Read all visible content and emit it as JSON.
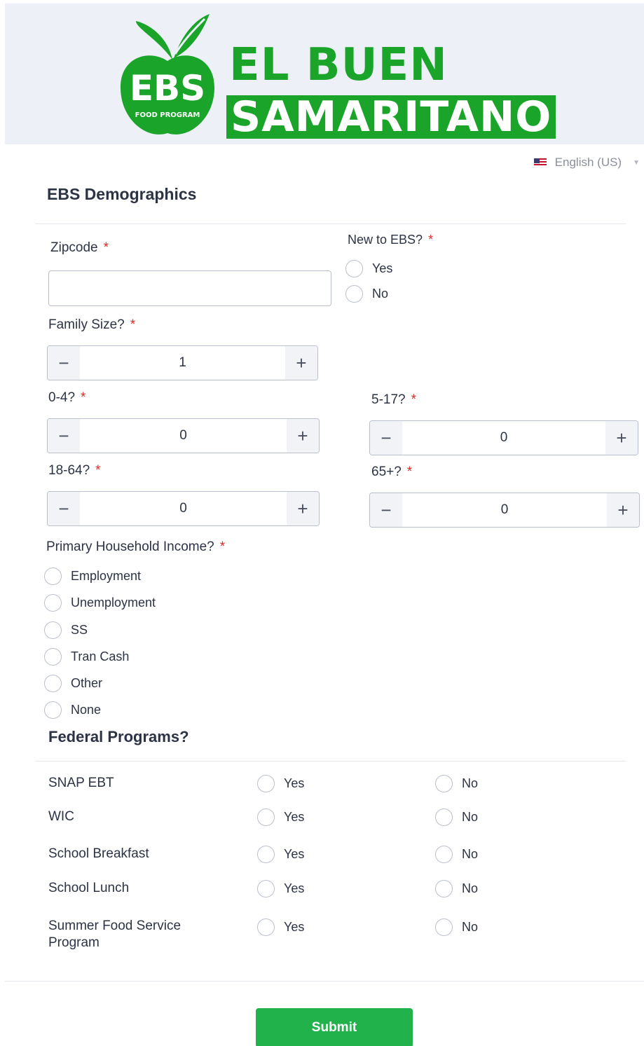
{
  "brand": {
    "logo_text": "EBS",
    "logo_subtext": "FOOD PROGRAM",
    "name_line1": "EL BUEN",
    "name_line2": "SAMARITANO",
    "green": "#1aa52a"
  },
  "language": {
    "selected": "English (US)",
    "flag_icon": "us-flag-icon"
  },
  "form": {
    "title": "EBS Demographics",
    "zipcode": {
      "label": "Zipcode",
      "value": ""
    },
    "new_to_ebs": {
      "label": "New to EBS?",
      "options": [
        "Yes",
        "No"
      ]
    },
    "family_size": {
      "label": "Family Size?",
      "value": "1"
    },
    "age_0_4": {
      "label": "0-4?",
      "value": "0"
    },
    "age_5_17": {
      "label": "5-17?",
      "value": "0"
    },
    "age_18_64": {
      "label": "18-64?",
      "value": "0"
    },
    "age_65": {
      "label": "65+?",
      "value": "0"
    },
    "income": {
      "label": "Primary Household Income?",
      "options": [
        "Employment",
        "Unemployment",
        "SS",
        "Tran Cash",
        "Other",
        "None"
      ]
    },
    "required_mark": "*",
    "stepper_minus": "−",
    "stepper_plus": "+"
  },
  "federal": {
    "title": "Federal Programs?",
    "yes_label": "Yes",
    "no_label": "No",
    "programs": [
      "SNAP EBT",
      "WIC",
      "School Breakfast",
      "School Lunch",
      "Summer Food Service Program"
    ]
  },
  "submit_label": "Submit"
}
